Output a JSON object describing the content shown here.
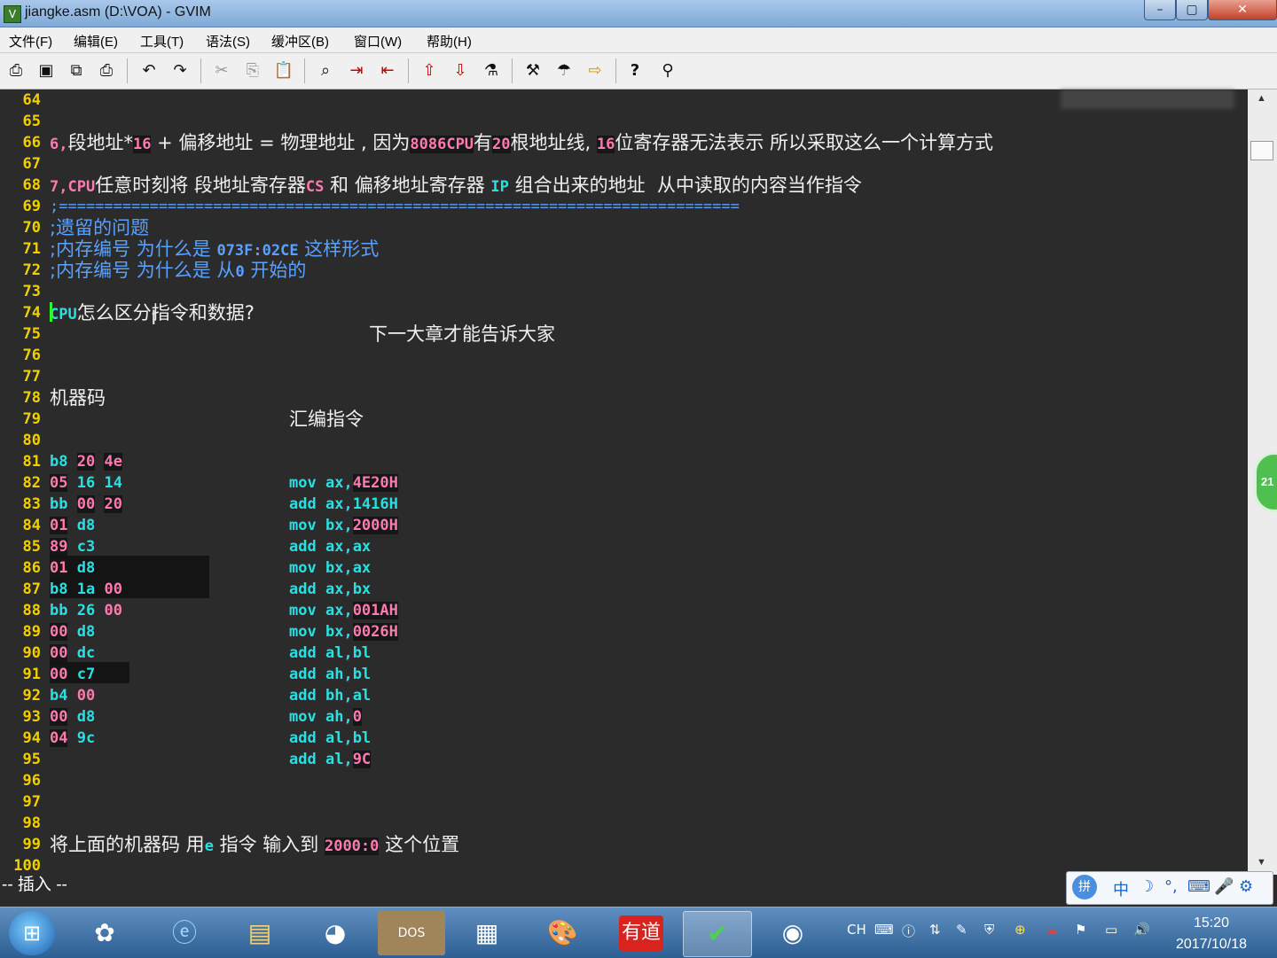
{
  "window": {
    "title": "jiangke.asm (D:\\VOA) - GVIM",
    "min": "–",
    "max": "▢",
    "close": "✕",
    "app_icon": "vim-icon"
  },
  "menu": [
    "文件(F)",
    "编辑(E)",
    "工具(T)",
    "语法(S)",
    "缓冲区(B)",
    "窗口(W)",
    "帮助(H)"
  ],
  "toolbar_icons": [
    "open-icon",
    "save-icon",
    "save-all-icon",
    "print-icon",
    "undo-icon",
    "redo-icon",
    "cut-icon",
    "copy-icon",
    "paste-icon",
    "find-replace-icon",
    "find-next-icon",
    "find-prev-icon",
    "load-session-icon",
    "save-session-icon",
    "run-script-icon",
    "make-icon",
    "run-ctags-icon",
    "tag-jump-icon",
    "help-icon",
    "find-help-icon"
  ],
  "editor": {
    "lines": {
      "l64": "64",
      "l65": "65",
      "l66": "66",
      "l67": "67",
      "l68": "68",
      "l69": "69",
      "l70": "70",
      "l71": "71",
      "l72": "72",
      "l73": "73",
      "l74": "74",
      "l75": "75",
      "l76": "76",
      "l77": "77",
      "l78": "78",
      "l79": "79",
      "l80": "80",
      "l81": "81",
      "l82": "82",
      "l83": "83",
      "l84": "84",
      "l85": "85",
      "l86": "86",
      "l87": "87",
      "l88": "88",
      "l89": "89",
      "l90": "90",
      "l91": "91",
      "l92": "92",
      "l93": "93",
      "l94": "94",
      "l95": "95",
      "l96": "96",
      "l97": "97",
      "l98": "98",
      "l99": "99",
      "l100": "100"
    },
    "t65": {
      "a": "6,",
      "b": "段地址*",
      "c": "16",
      "d": " + 偏移地址 = 物理地址 , 因为",
      "e": "8086CPU",
      "f": "有",
      "g": "20",
      "h": "根地址线, ",
      "i": "16",
      "j": "位寄存器无法表示 所以采取这么一个计算方式"
    },
    "t67": {
      "a": "7,",
      "b": "CPU",
      "c": "任意时刻将 段地址寄存器",
      "d": "CS",
      "e": " 和 偏移地址寄存器 ",
      "f": "IP",
      "g": " 组合出来的地址  从中读取的内容当作指令"
    },
    "t68": ";===========================================================================",
    "t69": ";遗留的问题",
    "t70": {
      "a": ";内存编号 为什么是 ",
      "b": "073F:02CE",
      "c": " 这样形式"
    },
    "t71": {
      "a": ";内存编号 为什么是 从",
      "b": "0",
      "c": " 开始的"
    },
    "t73": {
      "a": "CPU",
      "b": "怎么区分指令和数据?",
      "c": "下一大章才能告诉大家"
    },
    "t77": {
      "a": "机器码",
      "b": "汇编指令"
    },
    "code": [
      {
        "b1": "b8",
        "b2": "20",
        "b3": "4e",
        "op": "mov",
        "r": "ax,",
        "v": "4E20H"
      },
      {
        "b1": "05",
        "b2": "16",
        "b3": "14",
        "op": "add",
        "r": "ax,",
        "v": "1416H"
      },
      {
        "b1": "bb",
        "b2": "00",
        "b3": "20",
        "op": "mov",
        "r": "bx,",
        "v": "2000H"
      },
      {
        "b1": "01",
        "b2": "d8",
        "b3": "",
        "op": "add",
        "r": "ax,",
        "v": "ax"
      },
      {
        "b1": "89",
        "b2": "c3",
        "b3": "",
        "op": "mov",
        "r": "bx,",
        "v": "ax"
      },
      {
        "b1": "01",
        "b2": "d8",
        "b3": "",
        "op": "add",
        "r": "ax,",
        "v": "bx"
      },
      {
        "b1": "b8",
        "b2": "1a",
        "b3": "00",
        "op": "mov",
        "r": "ax,",
        "v": "001AH"
      },
      {
        "b1": "bb",
        "b2": "26",
        "b3": "00",
        "op": "mov",
        "r": "bx,",
        "v": "0026H"
      },
      {
        "b1": "00",
        "b2": "d8",
        "b3": "",
        "op": "add",
        "r": "al,",
        "v": "bl"
      },
      {
        "b1": "00",
        "b2": "dc",
        "b3": "",
        "op": "add",
        "r": "ah,",
        "v": "bl"
      },
      {
        "b1": "00",
        "b2": "c7",
        "b3": "",
        "op": "add",
        "r": "bh,",
        "v": "al"
      },
      {
        "b1": "b4",
        "b2": "00",
        "b3": "",
        "op": "mov",
        "r": "ah,",
        "v": "0"
      },
      {
        "b1": "00",
        "b2": "d8",
        "b3": "",
        "op": "add",
        "r": "al,",
        "v": "bl"
      },
      {
        "b1": "04",
        "b2": "9c",
        "b3": "",
        "op": "add",
        "r": "al,",
        "v": "9C"
      }
    ],
    "t98": {
      "a": "将上面的机器码 用",
      "b": "e",
      "c": " 指令 输入到 ",
      "d": "2000:0",
      "e": " 这个位置"
    }
  },
  "status": {
    "mode": "-- 插入 --"
  },
  "ime": {
    "c1": "中",
    "c2": "☽",
    "c3": "°,",
    "c4": "⌨",
    "c5": "🎤",
    "c6": "⚙",
    "logo": "拼"
  },
  "side_badge": "21",
  "taskbar": {
    "apps": [
      "360-icon",
      "ie-icon",
      "explorer-icon",
      "color-picker-icon",
      "dosbox-icon",
      "calculator-icon",
      "paint-icon",
      "youdao-icon",
      "gvim-icon",
      "obs-icon"
    ],
    "youdao": "有道",
    "dosbox": "DOS",
    "tray_lang": "CH",
    "time": "15:20",
    "date": "2017/10/18"
  }
}
